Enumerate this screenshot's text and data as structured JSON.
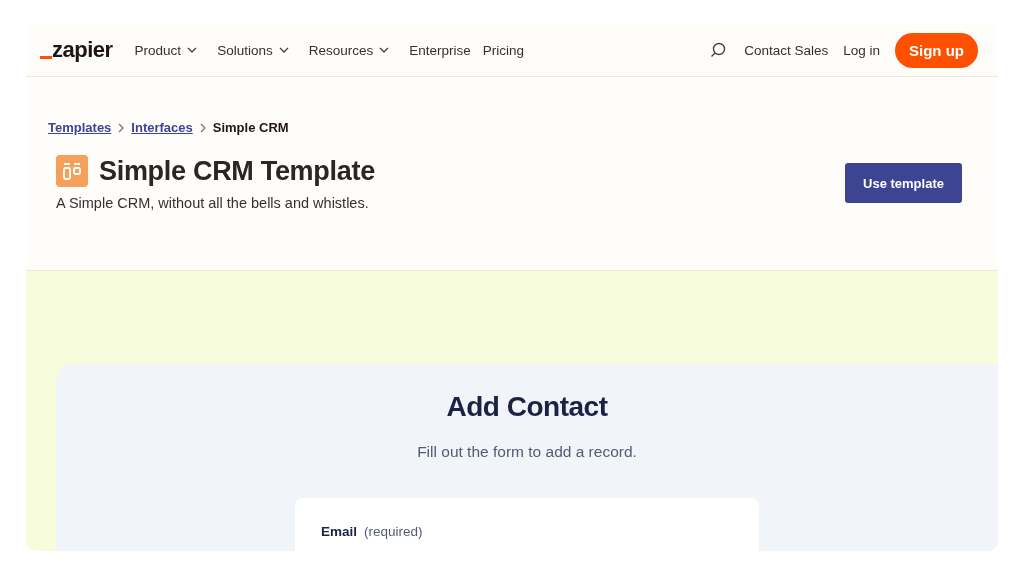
{
  "logo": {
    "text": "zapier"
  },
  "nav": [
    {
      "label": "Product",
      "kind": "dropdown"
    },
    {
      "label": "Solutions",
      "kind": "dropdown"
    },
    {
      "label": "Resources",
      "kind": "dropdown"
    },
    {
      "label": "Enterprise",
      "kind": "link"
    },
    {
      "label": "Pricing",
      "kind": "link"
    }
  ],
  "nav_right": [
    {
      "label": "Contact Sales",
      "kind": "link"
    },
    {
      "label": "Log in",
      "kind": "link"
    },
    {
      "label": "Sign up",
      "kind": "primary"
    }
  ],
  "breadcrumbs": [
    {
      "label": "Templates",
      "kind": "link"
    },
    {
      "label": "Interfaces",
      "kind": "link"
    },
    {
      "label": "Simple CRM",
      "kind": "current"
    }
  ],
  "header": {
    "title": "Simple CRM Template",
    "description": "A Simple CRM, without all the bells and whistles.",
    "button": "Use template"
  },
  "preview": {
    "title": "Add Contact",
    "subtitle": "Fill out the form to add a record.",
    "fields": [
      {
        "label": "Email",
        "note": "(required)"
      }
    ]
  }
}
